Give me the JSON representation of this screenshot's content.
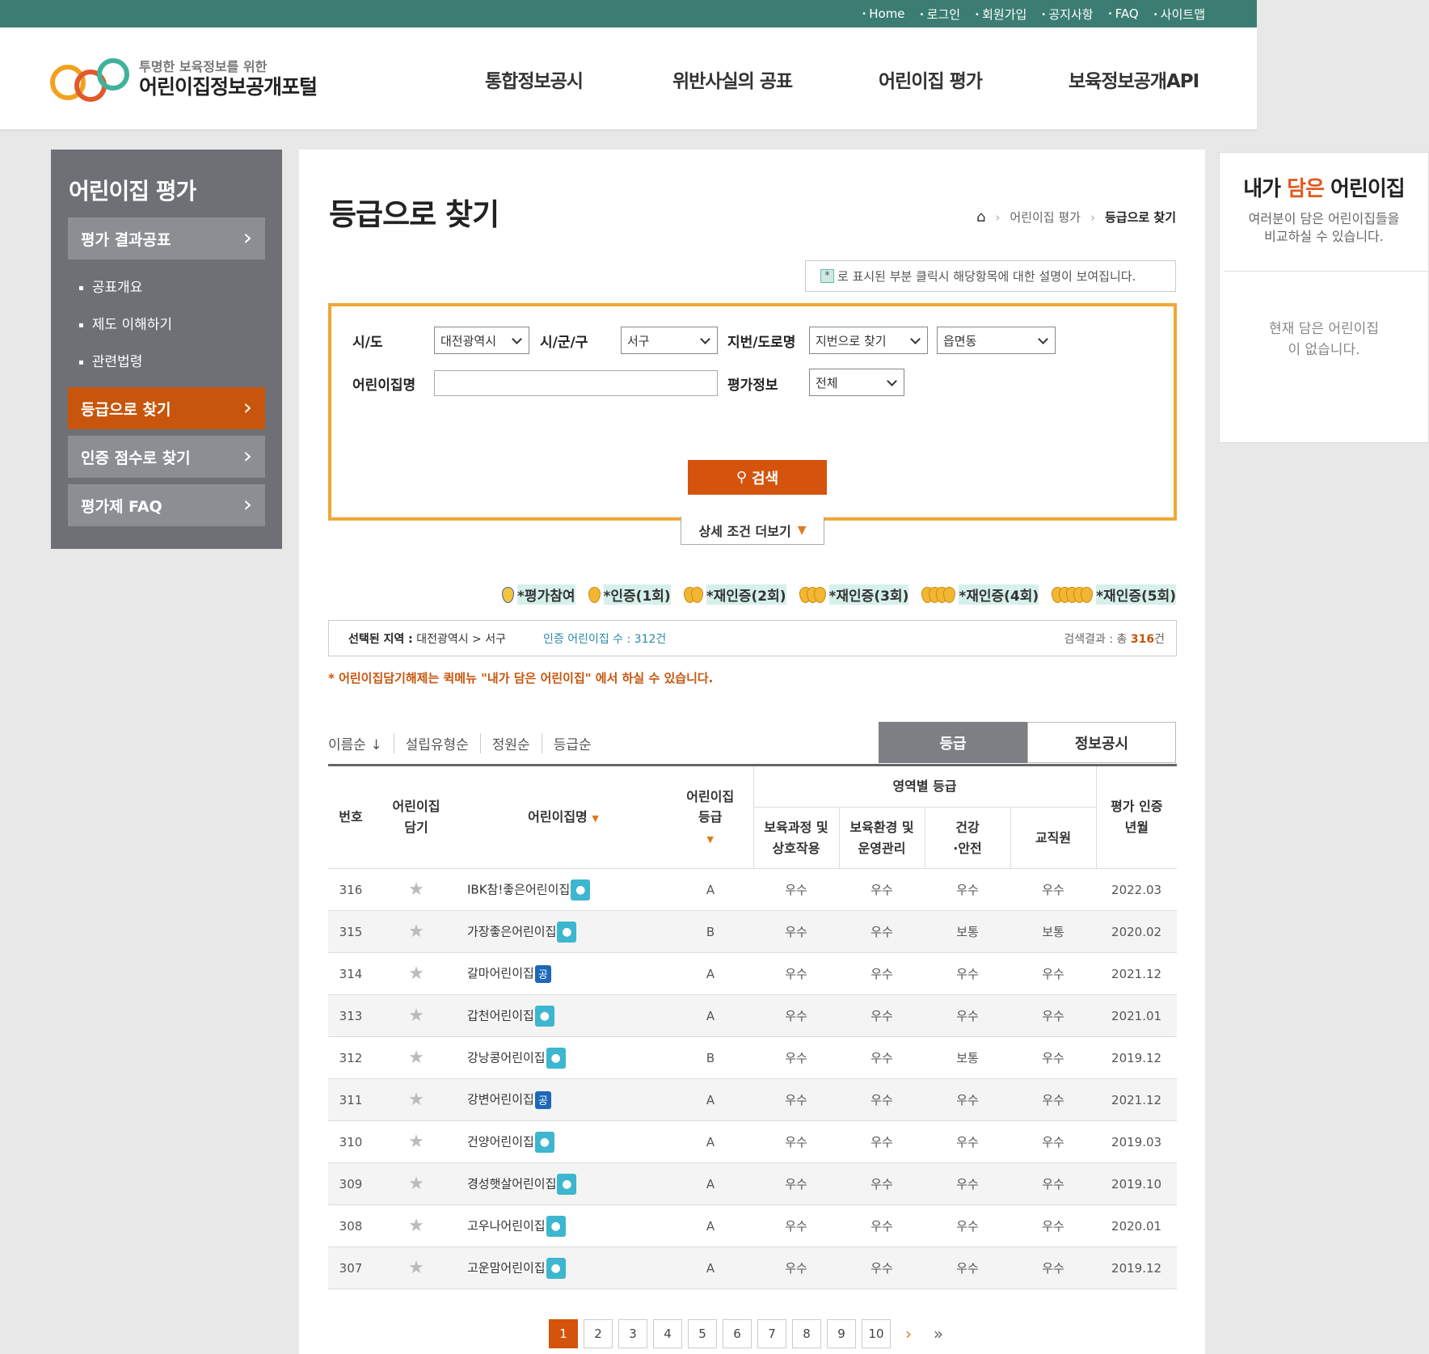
{
  "topbar": {
    "links": [
      "Home",
      "로그인",
      "회원가입",
      "공지사항",
      "FAQ",
      "사이트맵"
    ]
  },
  "logo": {
    "sub": "투명한 보육정보를 위한",
    "main": "어린이집정보공개포털"
  },
  "gnav": [
    "통합정보공시",
    "위반사실의 공표",
    "어린이집 평가",
    "보육정보공개API"
  ],
  "lnb": {
    "title": "어린이집 평가",
    "items": [
      "평가 결과공표",
      "등급으로 찾기",
      "인증 점수로 찾기",
      "평가제 FAQ"
    ],
    "subs": [
      "공표개요",
      "제도 이해하기",
      "관련법령"
    ]
  },
  "page": {
    "title": "등급으로 찾기",
    "breadcrumb": [
      "어린이집 평가",
      "등급으로 찾기"
    ],
    "note_mark": "*",
    "note": "로 표시된 부분 클릭시 해당항목에 대한 설명이 보여집니다."
  },
  "search": {
    "sido_label": "시/도",
    "sido_value": "대전광역시",
    "sigungu_label": "시/군/구",
    "sigungu_value": "서구",
    "addr_label": "지번/도로명",
    "addr_value": "지번으로 찾기",
    "dong_value": "읍면동",
    "name_label": "어린이집명",
    "name_value": "",
    "eval_label": "평가정보",
    "eval_value": "전체",
    "button": "검색",
    "more": "상세 조건 더보기"
  },
  "legend": [
    "*평가참여",
    "*인증(1회)",
    "*재인증(2회)",
    "*재인증(3회)",
    "*재인증(4회)",
    "*재인증(5회)"
  ],
  "info": {
    "region_label": "선택된 지역 :",
    "region": "대전광역시 > 서구",
    "cert": "인증 어린이집 수 : 312건",
    "result_prefix": "검색결과 : 총",
    "result_count": "316",
    "result_suffix": "건"
  },
  "warning": "* 어린이집담기해제는 퀵메뉴 \"내가 담은 어린이집\" 에서 하실 수 있습니다.",
  "sorts": [
    "이름순 ↓",
    "설립유형순",
    "정원순",
    "등급순"
  ],
  "tabs": [
    "등급",
    "정보공시"
  ],
  "table": {
    "h_no": "번호",
    "h_keep": "어린이집\n담기",
    "h_name": "어린이집명",
    "h_grade": "어린이집\n등급",
    "h_area": "영역별 등급",
    "h_a1": "보육과정 및\n상호작용",
    "h_a2": "보육환경 및\n운영관리",
    "h_a3": "건강\n·안전",
    "h_a4": "교직원",
    "h_date": "평가 인증\n년월",
    "rows": [
      {
        "no": "316",
        "name": "IBK참!좋은어린이집",
        "badge": "map",
        "grade": "A",
        "a1": "우수",
        "a2": "우수",
        "a3": "우수",
        "a4": "우수",
        "date": "2022.03"
      },
      {
        "no": "315",
        "name": "가장좋은어린이집",
        "badge": "map",
        "grade": "B",
        "a1": "우수",
        "a2": "우수",
        "a3": "보통",
        "a4": "보통",
        "date": "2020.02"
      },
      {
        "no": "314",
        "name": "갈마어린이집",
        "badge": "pub",
        "grade": "A",
        "a1": "우수",
        "a2": "우수",
        "a3": "우수",
        "a4": "우수",
        "date": "2021.12"
      },
      {
        "no": "313",
        "name": "갑천어린이집",
        "badge": "map",
        "grade": "A",
        "a1": "우수",
        "a2": "우수",
        "a3": "우수",
        "a4": "우수",
        "date": "2021.01"
      },
      {
        "no": "312",
        "name": "강낭콩어린이집",
        "badge": "map",
        "grade": "B",
        "a1": "우수",
        "a2": "우수",
        "a3": "보통",
        "a4": "우수",
        "date": "2019.12"
      },
      {
        "no": "311",
        "name": "강변어린이집",
        "badge": "pub",
        "grade": "A",
        "a1": "우수",
        "a2": "우수",
        "a3": "우수",
        "a4": "우수",
        "date": "2021.12"
      },
      {
        "no": "310",
        "name": "건양어린이집",
        "badge": "map",
        "grade": "A",
        "a1": "우수",
        "a2": "우수",
        "a3": "우수",
        "a4": "우수",
        "date": "2019.03"
      },
      {
        "no": "309",
        "name": "경성햇살어린이집",
        "badge": "map",
        "grade": "A",
        "a1": "우수",
        "a2": "우수",
        "a3": "우수",
        "a4": "우수",
        "date": "2019.10"
      },
      {
        "no": "308",
        "name": "고우나어린이집",
        "badge": "map",
        "grade": "A",
        "a1": "우수",
        "a2": "우수",
        "a3": "우수",
        "a4": "우수",
        "date": "2020.01"
      },
      {
        "no": "307",
        "name": "고운맘어린이집",
        "badge": "map",
        "grade": "A",
        "a1": "우수",
        "a2": "우수",
        "a3": "우수",
        "a4": "우수",
        "date": "2019.12"
      }
    ]
  },
  "badges": {
    "map": "map-pin-icon",
    "pub": "공"
  },
  "pager": {
    "pages": [
      "1",
      "2",
      "3",
      "4",
      "5",
      "6",
      "7",
      "8",
      "9",
      "10"
    ],
    "next": "›",
    "last": "»"
  },
  "aside": {
    "title_pre": "내가 ",
    "title_em": "담은",
    "title_post": " 어린이집",
    "desc": "여러분이 담은 어린이집들을 비교하실 수 있습니다.",
    "empty": "현재 담은 어린이집이 없습니다."
  },
  "colors": {
    "topbar": "#3b7d72",
    "accent": "#d4540d",
    "border": "#f0a737"
  }
}
